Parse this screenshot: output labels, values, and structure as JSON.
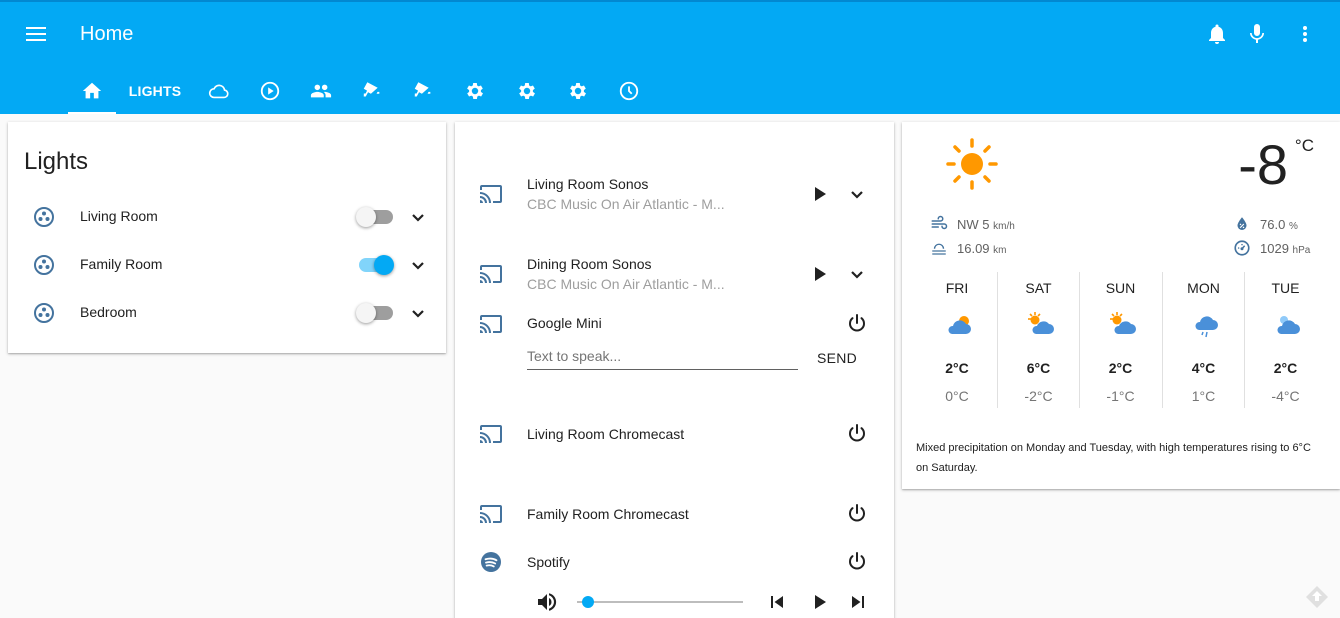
{
  "app": {
    "title": "Home"
  },
  "tabs": [
    {
      "name": "home",
      "icon": "home-icon"
    },
    {
      "name": "lights",
      "label": "LIGHTS"
    },
    {
      "name": "weather",
      "icon": "cloud-icon"
    },
    {
      "name": "media",
      "icon": "play-circle-icon"
    },
    {
      "name": "people",
      "icon": "people-icon"
    },
    {
      "name": "camera-1",
      "icon": "cctv-icon"
    },
    {
      "name": "camera-2",
      "icon": "cctv-icon"
    },
    {
      "name": "settings-1",
      "icon": "gear-icon"
    },
    {
      "name": "settings-2",
      "icon": "gear-icon"
    },
    {
      "name": "settings-3",
      "icon": "gear-icon"
    },
    {
      "name": "history",
      "icon": "clock-icon"
    }
  ],
  "lights_card": {
    "title": "Lights",
    "items": [
      {
        "label": "Living Room",
        "on": false
      },
      {
        "label": "Family Room",
        "on": true
      },
      {
        "label": "Bedroom",
        "on": false
      }
    ]
  },
  "media": {
    "players": [
      {
        "name": "Living Room Sonos",
        "subtitle": "CBC Music On Air Atlantic - M..."
      },
      {
        "name": "Dining Room Sonos",
        "subtitle": "CBC Music On Air Atlantic - M..."
      },
      {
        "name": "Google Mini"
      },
      {
        "name": "Living Room Chromecast"
      },
      {
        "name": "Family Room Chromecast"
      },
      {
        "name": "Spotify"
      }
    ],
    "tts_placeholder": "Text to speak...",
    "send_label": "SEND",
    "volume_level": 0.03
  },
  "weather": {
    "temperature": "-8",
    "unit": "°C",
    "condition_icon": "sun-icon",
    "wind": "NW 5",
    "wind_unit": "km/h",
    "visibility": "16.09",
    "visibility_unit": "km",
    "humidity": "76.0",
    "humidity_unit": "%",
    "pressure": "1029",
    "pressure_unit": "hPa",
    "forecast": [
      {
        "day": "FRI",
        "high": "2°C",
        "low": "0°C",
        "icon": "partly-cloudy-icon"
      },
      {
        "day": "SAT",
        "high": "6°C",
        "low": "-2°C",
        "icon": "partly-sunny-icon"
      },
      {
        "day": "SUN",
        "high": "2°C",
        "low": "-1°C",
        "icon": "partly-sunny-icon"
      },
      {
        "day": "MON",
        "high": "4°C",
        "low": "1°C",
        "icon": "rain-icon"
      },
      {
        "day": "TUE",
        "high": "2°C",
        "low": "-4°C",
        "icon": "snow-icon"
      }
    ],
    "summary": "Mixed precipitation on Monday and Tuesday, with high temperatures rising to 6°C on Saturday."
  },
  "colors": {
    "primary": "#03a9f4",
    "icon": "#44739e",
    "sun": "#ff9800"
  }
}
